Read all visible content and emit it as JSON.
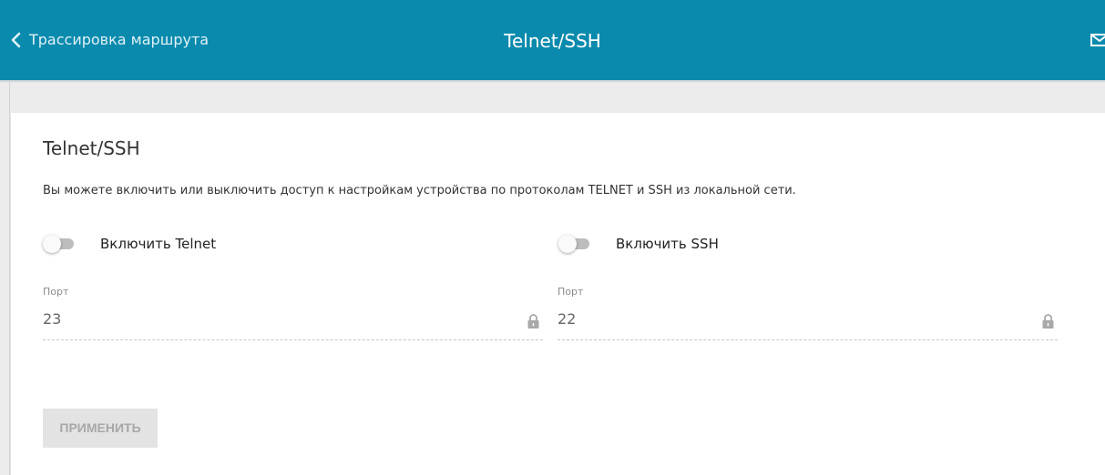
{
  "header": {
    "back_label": "Трассировка маршрута",
    "title": "Telnet/SSH",
    "back_icon": "chevron-left-icon",
    "mail_icon": "mail-icon"
  },
  "section": {
    "title": "Telnet/SSH",
    "description": "Вы можете включить или выключить доступ к настройкам устройства по протоколам TELNET и SSH из локальной сети."
  },
  "telnet": {
    "toggle_label": "Включить Telnet",
    "enabled": false,
    "port_label": "Порт",
    "port_value": "23"
  },
  "ssh": {
    "toggle_label": "Включить SSH",
    "enabled": false,
    "port_label": "Порт",
    "port_value": "22"
  },
  "actions": {
    "apply_label": "ПРИМЕНИТЬ"
  },
  "colors": {
    "header_bg": "#0a8aad",
    "page_bg": "#ececec",
    "toggle_off": "#bdbdbd",
    "button_disabled": "#e3e3e3"
  }
}
